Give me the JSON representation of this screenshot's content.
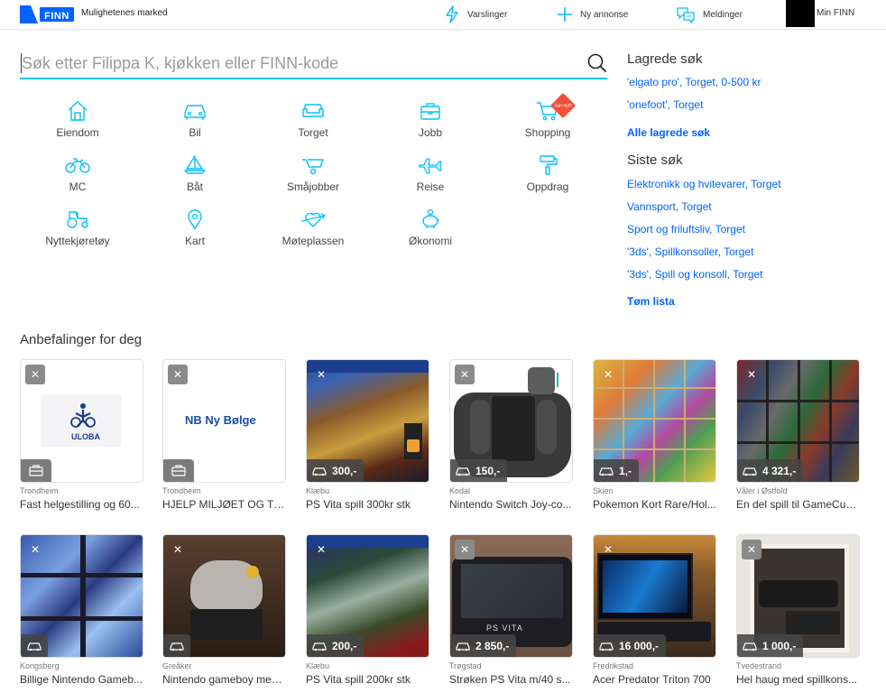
{
  "header": {
    "logo_text": "FINN",
    "tagline": "Mulighetenes marked",
    "nav": [
      {
        "label": "Varslinger",
        "icon": "bolt-icon"
      },
      {
        "label": "Ny annonse",
        "icon": "plus-icon"
      },
      {
        "label": "Meldinger",
        "icon": "chat-icon"
      },
      {
        "label": "Min FINN",
        "icon": "avatar"
      }
    ]
  },
  "search": {
    "placeholder": "Søk etter Filippa K, kjøkken eller FINN-kode"
  },
  "categories": [
    {
      "label": "Eiendom",
      "icon": "house-icon"
    },
    {
      "label": "Bil",
      "icon": "car-icon"
    },
    {
      "label": "Torget",
      "icon": "sofa-icon"
    },
    {
      "label": "Jobb",
      "icon": "briefcase-icon"
    },
    {
      "label": "Shopping",
      "icon": "cart-icon",
      "badge": "kun nytt!"
    },
    {
      "label": "MC",
      "icon": "motorcycle-icon"
    },
    {
      "label": "Båt",
      "icon": "sailboat-icon"
    },
    {
      "label": "Småjobber",
      "icon": "wheelbarrow-icon"
    },
    {
      "label": "Reise",
      "icon": "airplane-icon"
    },
    {
      "label": "Oppdrag",
      "icon": "paint-roller-icon"
    },
    {
      "label": "Nyttekjøretøy",
      "icon": "tractor-icon"
    },
    {
      "label": "Kart",
      "icon": "map-pin-icon"
    },
    {
      "label": "Møteplassen",
      "icon": "heart-arrow-icon"
    },
    {
      "label": "Økonomi",
      "icon": "piggy-bank-icon"
    }
  ],
  "saved_searches": {
    "title": "Lagrede søk",
    "items": [
      "'elgato pro', Torget, 0-500 kr",
      "'onefoot', Torget"
    ],
    "all_label": "Alle lagrede søk"
  },
  "recent_searches": {
    "title": "Siste søk",
    "items": [
      "Elektronikk og hvitevarer, Torget",
      "Vannsport, Torget",
      "Sport og friluftsliv, Torget",
      "'3ds', Spillkonsoller, Torget",
      "'3ds', Spill og konsoll, Torget"
    ],
    "clear_label": "Tøm lista"
  },
  "recommendations": {
    "title": "Anbefalinger for deg",
    "items": [
      {
        "location": "Trondheim",
        "title": "Fast helgestilling og 60...",
        "price": "",
        "type": "job",
        "logo": "ULOBA"
      },
      {
        "location": "Trondheim",
        "title": "HJELP MILJØET OG TJ...",
        "price": "",
        "type": "job",
        "logo": "NB Ny Bølge"
      },
      {
        "location": "Klæbu",
        "title": "PS Vita spill 300kr stk",
        "price": "300,-",
        "type": "item"
      },
      {
        "location": "Kodal",
        "title": "Nintendo Switch Joy-co...",
        "price": "150,-",
        "type": "item"
      },
      {
        "location": "Skien",
        "title": "Pokemon Kort Rare/Hol...",
        "price": "1,-",
        "type": "item"
      },
      {
        "location": "Våler i Østfold",
        "title": "En del spill til GameCub...",
        "price": "4 321,-",
        "type": "item"
      },
      {
        "location": "Kongsberg",
        "title": "Billige Nintendo Gameb...",
        "price": "",
        "type": "item"
      },
      {
        "location": "Greåker",
        "title": "Nintendo gameboy med...",
        "price": "",
        "type": "item"
      },
      {
        "location": "Klæbu",
        "title": "PS Vita spill 200kr stk",
        "price": "200,-",
        "type": "item"
      },
      {
        "location": "Trøgstad",
        "title": "Strøken PS Vita m/40 s...",
        "price": "2 850,-",
        "type": "item"
      },
      {
        "location": "Fredrikstad",
        "title": "Acer Predator Triton 700",
        "price": "16 000,-",
        "type": "item"
      },
      {
        "location": "Tvedestrand",
        "title": "Hel haug med spillkons...",
        "price": "1 000,-",
        "type": "item"
      }
    ]
  },
  "colors": {
    "brand": "#0063fb",
    "accent": "#06bffc",
    "link": "#0063fb",
    "badge": "#f0503a"
  }
}
